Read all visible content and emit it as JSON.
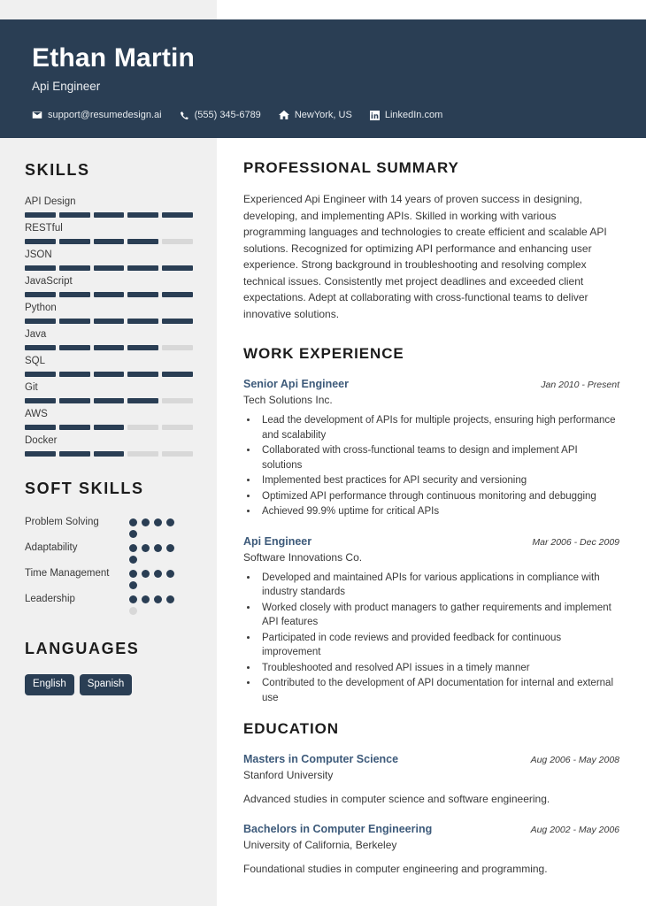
{
  "theme": {
    "accent_dark": "#2a3e54",
    "sidebar_bg": "#f0f0f0",
    "title_blue": "#3d5a7a",
    "bar_empty": "#d8d8d8",
    "page_bg": "#ffffff"
  },
  "header": {
    "name": "Ethan Martin",
    "role": "Api Engineer",
    "contacts": [
      {
        "icon": "envelope-icon",
        "text": "support@resumedesign.ai"
      },
      {
        "icon": "phone-icon",
        "text": "(555) 345-6789"
      },
      {
        "icon": "home-icon",
        "text": "NewYork, US"
      },
      {
        "icon": "linkedin-icon",
        "text": "LinkedIn.com"
      }
    ]
  },
  "sidebar": {
    "skills_heading": "SKILLS",
    "skills": [
      {
        "label": "API Design",
        "level": 5,
        "max": 5
      },
      {
        "label": "RESTful",
        "level": 4,
        "max": 5
      },
      {
        "label": "JSON",
        "level": 5,
        "max": 5
      },
      {
        "label": "JavaScript",
        "level": 5,
        "max": 5
      },
      {
        "label": "Python",
        "level": 5,
        "max": 5
      },
      {
        "label": "Java",
        "level": 4,
        "max": 5
      },
      {
        "label": "SQL",
        "level": 5,
        "max": 5
      },
      {
        "label": "Git",
        "level": 4,
        "max": 5
      },
      {
        "label": "AWS",
        "level": 3,
        "max": 5
      },
      {
        "label": "Docker",
        "level": 3,
        "max": 5
      }
    ],
    "soft_skills_heading": "SOFT SKILLS",
    "soft_skills": [
      {
        "label": "Problem Solving",
        "level": 5,
        "max": 5
      },
      {
        "label": "Adaptability",
        "level": 5,
        "max": 5
      },
      {
        "label": "Time Management",
        "level": 5,
        "max": 5
      },
      {
        "label": "Leadership",
        "level": 4,
        "max": 5
      }
    ],
    "languages_heading": "LANGUAGES",
    "languages": [
      "English",
      "Spanish"
    ]
  },
  "main": {
    "summary_heading": "PROFESSIONAL SUMMARY",
    "summary_text": "Experienced Api Engineer with 14 years of proven success in designing, developing, and implementing APIs. Skilled in working with various programming languages and technologies to create efficient and scalable API solutions. Recognized for optimizing API performance and enhancing user experience. Strong background in troubleshooting and resolving complex technical issues. Consistently met project deadlines and exceeded client expectations. Adept at collaborating with cross-functional teams to deliver innovative solutions.",
    "experience_heading": "WORK EXPERIENCE",
    "experience": [
      {
        "title": "Senior Api Engineer",
        "company": "Tech Solutions Inc.",
        "date": "Jan 2010 - Present",
        "bullets": [
          "Lead the development of APIs for multiple projects, ensuring high performance and scalability",
          "Collaborated with cross-functional teams to design and implement API solutions",
          "Implemented best practices for API security and versioning",
          "Optimized API performance through continuous monitoring and debugging",
          "Achieved 99.9% uptime for critical APIs"
        ]
      },
      {
        "title": "Api Engineer",
        "company": "Software Innovations Co.",
        "date": "Mar 2006 - Dec 2009",
        "bullets": [
          "Developed and maintained APIs for various applications in compliance with industry standards",
          "Worked closely with product managers to gather requirements and implement API features",
          "Participated in code reviews and provided feedback for continuous improvement",
          "Troubleshooted and resolved API issues in a timely manner",
          "Contributed to the development of API documentation for internal and external use"
        ]
      }
    ],
    "education_heading": "EDUCATION",
    "education": [
      {
        "degree": "Masters in Computer Science",
        "school": "Stanford University",
        "date": "Aug 2006 - May 2008",
        "description": "Advanced studies in computer science and software engineering."
      },
      {
        "degree": "Bachelors in Computer Engineering",
        "school": "University of California, Berkeley",
        "date": "Aug 2002 - May 2006",
        "description": "Foundational studies in computer engineering and programming."
      }
    ]
  }
}
